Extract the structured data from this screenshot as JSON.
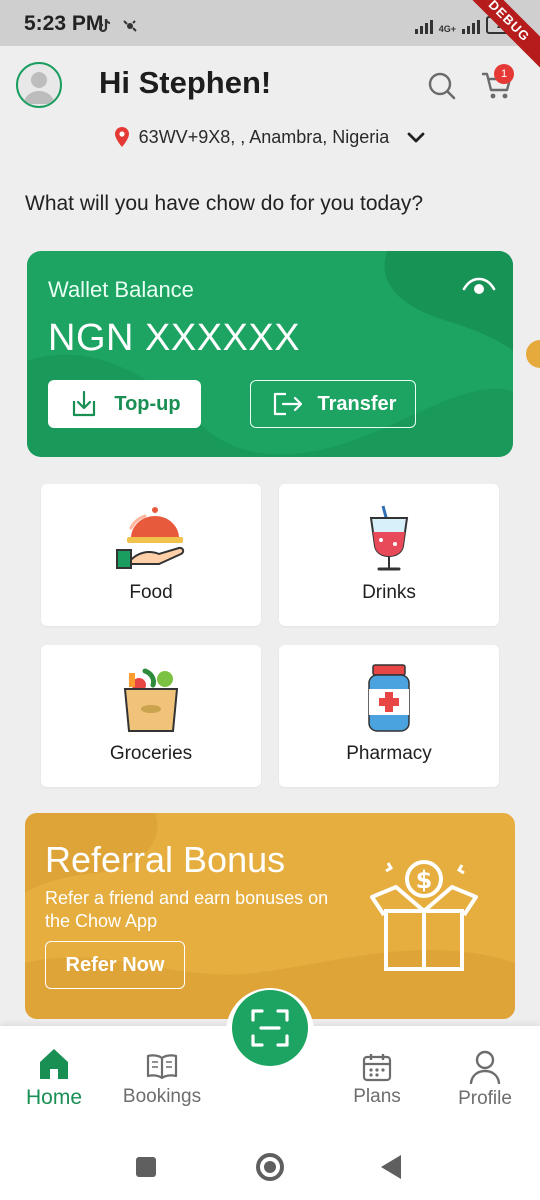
{
  "status_bar": {
    "time": "5:23 PM",
    "network": "4G+",
    "battery": "25",
    "debug": "DEBUG"
  },
  "header": {
    "greeting": "Hi Stephen!",
    "cart_count": "1"
  },
  "location": {
    "text": "63WV+9X8, , Anambra, Nigeria"
  },
  "prompt": "What will you have chow do for you today?",
  "wallet": {
    "title": "Wallet Balance",
    "amount": "NGN XXXXXX",
    "topup_label": "Top-up",
    "transfer_label": "Transfer"
  },
  "categories": [
    {
      "label": "Food",
      "icon": "food-platter-icon"
    },
    {
      "label": "Drinks",
      "icon": "cocktail-icon"
    },
    {
      "label": "Groceries",
      "icon": "grocery-bag-icon"
    },
    {
      "label": "Pharmacy",
      "icon": "medicine-bottle-icon"
    }
  ],
  "referral": {
    "title": "Referral Bonus",
    "text": "Refer a friend and earn bonuses on the Chow App",
    "button": "Refer Now"
  },
  "nav": {
    "items": [
      {
        "label": "Home",
        "icon": "home-icon",
        "active": true
      },
      {
        "label": "Bookings",
        "icon": "book-icon",
        "active": false
      },
      {
        "label": "Plans",
        "icon": "calendar-icon",
        "active": false
      },
      {
        "label": "Profile",
        "icon": "person-icon",
        "active": false
      }
    ]
  },
  "colors": {
    "brand_green": "#1da462",
    "referral_gold": "#e6ad3f",
    "badge_red": "#e53935"
  }
}
